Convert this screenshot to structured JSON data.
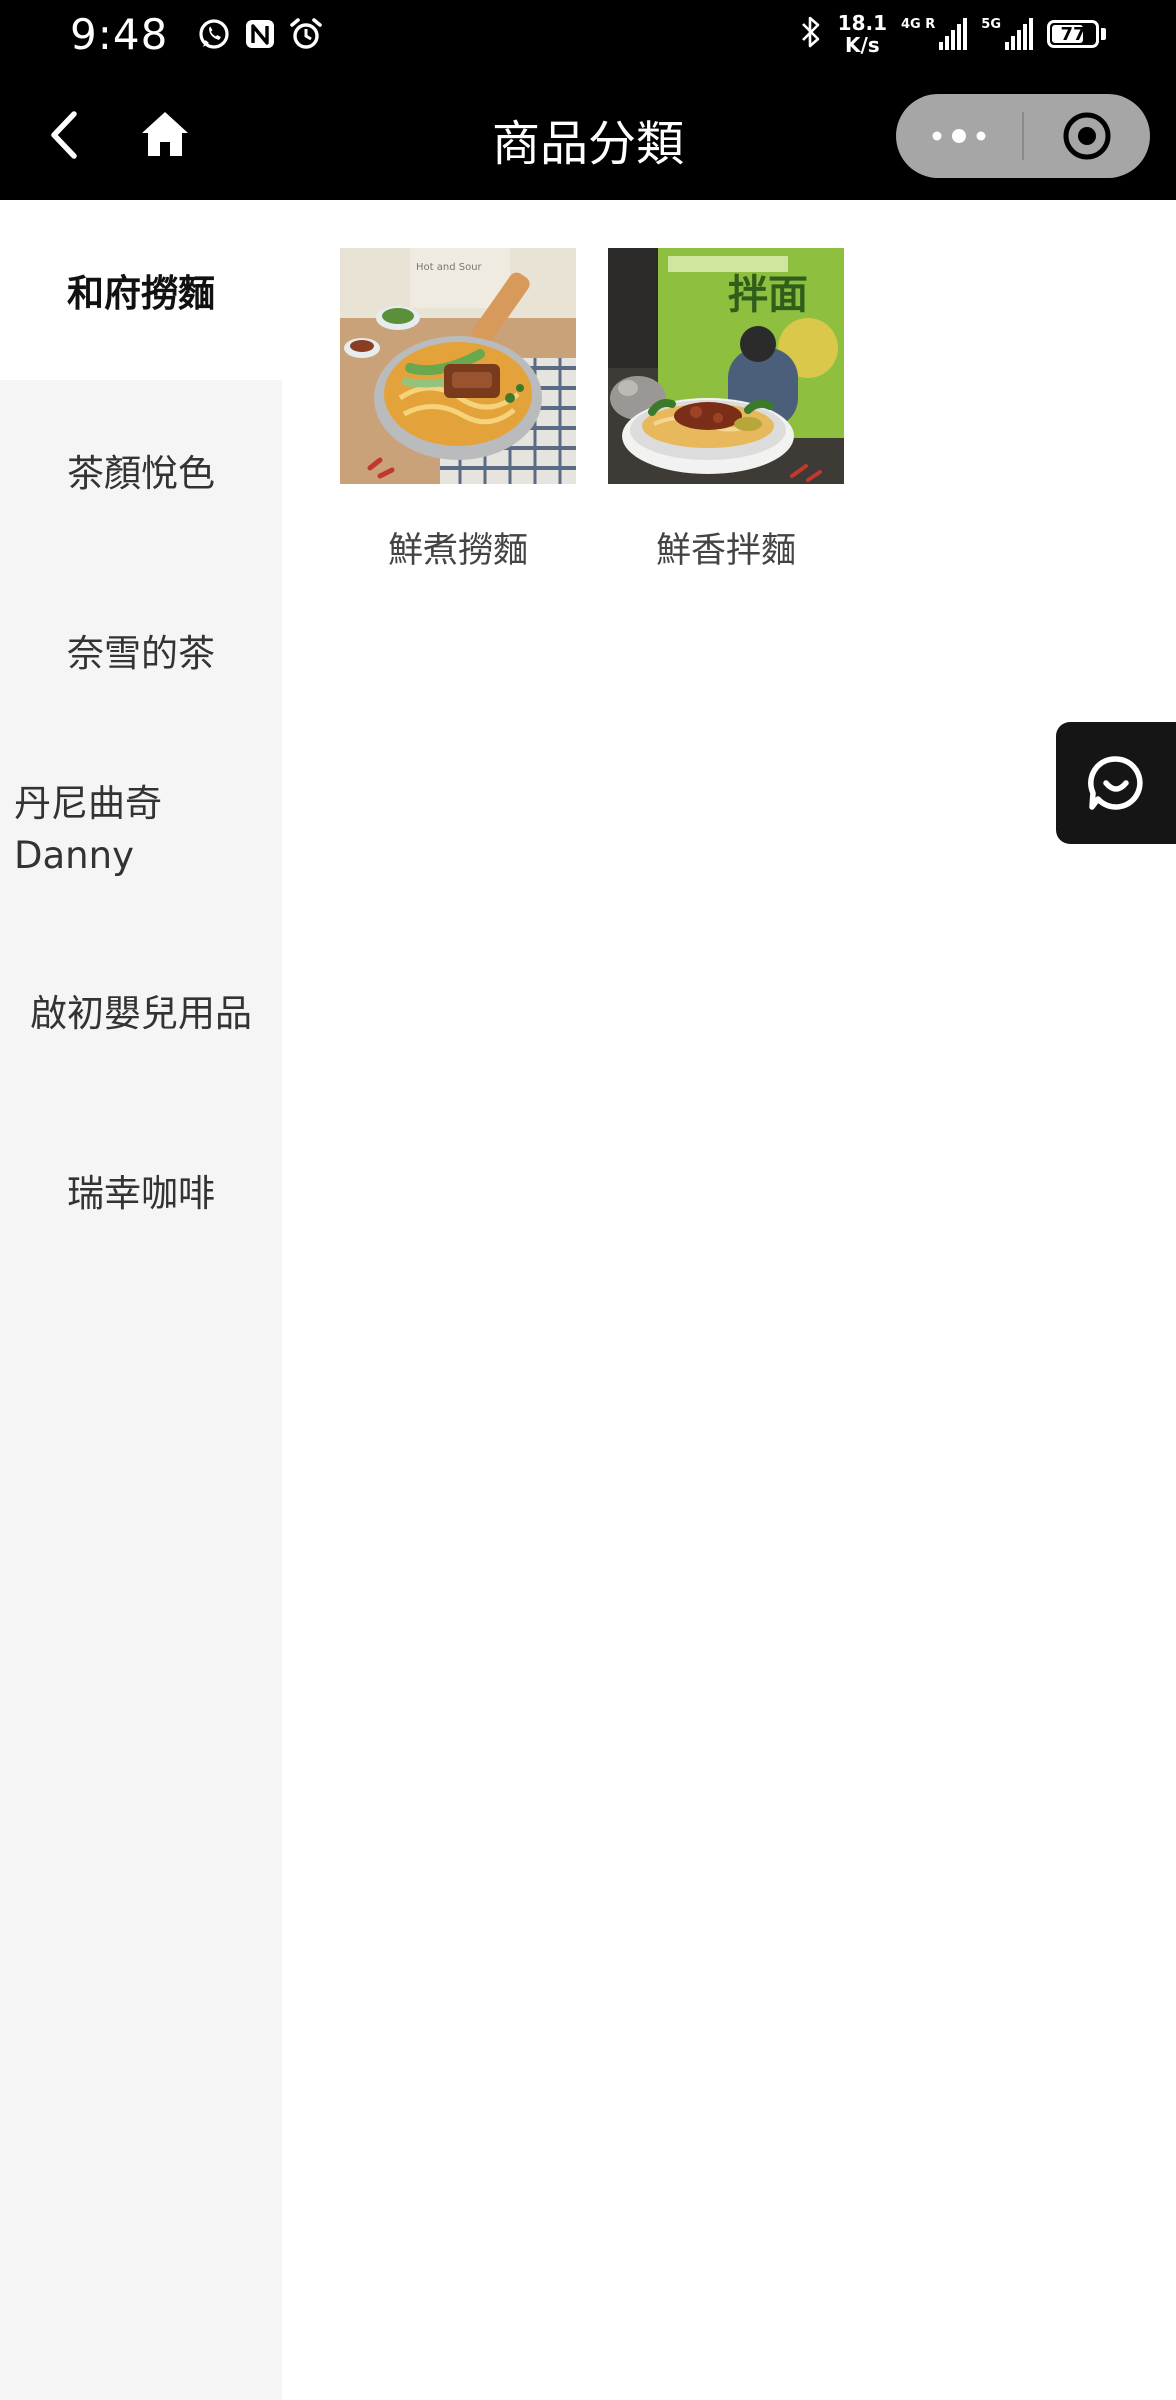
{
  "status_bar": {
    "time": "9:48",
    "net_speed_value": "18.1",
    "net_speed_unit": "K/s",
    "signal_1_label": "4G R",
    "signal_2_label": "5G",
    "battery_level": "77",
    "icons": [
      "whatsapp-icon",
      "nfc-icon",
      "alarm-icon",
      "bluetooth-icon"
    ]
  },
  "header": {
    "title": "商品分類",
    "back_icon": "chevron-left-icon",
    "home_icon": "home-icon",
    "capsule_more_icon": "more-dots-icon",
    "capsule_close_icon": "target-circle-icon"
  },
  "sidebar": {
    "items": [
      {
        "label": "和府撈麵",
        "active": true
      },
      {
        "label": "茶顏悅色",
        "active": false
      },
      {
        "label": "奈雪的茶",
        "active": false
      },
      {
        "label": "丹尼曲奇 Danny",
        "active": false
      },
      {
        "label": "啟初嬰兒用品",
        "active": false
      },
      {
        "label": "瑞幸咖啡",
        "active": false
      }
    ]
  },
  "products": [
    {
      "name": "鮮煮撈麵"
    },
    {
      "name": "鮮香拌麵"
    }
  ],
  "floating": {
    "service_icon": "chat-bubble-icon"
  },
  "colors": {
    "header_bg": "#000000",
    "sidebar_bg": "#f5f5f5",
    "sidebar_active_bg": "#ffffff",
    "capsule_bg": "#a6a6a6",
    "service_btn_bg": "#151515"
  }
}
